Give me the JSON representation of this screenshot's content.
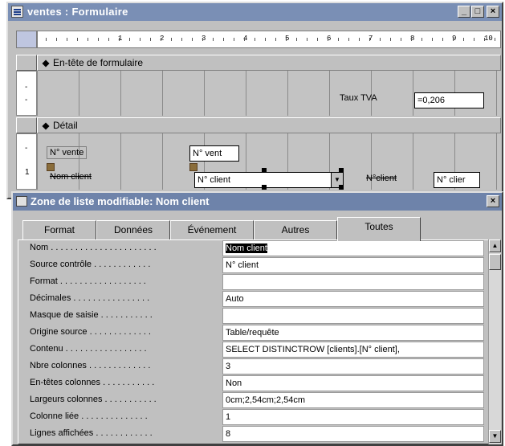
{
  "form_window": {
    "title": "ventes : Formulaire",
    "controls": {
      "minimize": "_",
      "maximize": "□",
      "close": "×"
    },
    "ruler_numbers": [
      "1",
      "2",
      "3",
      "4",
      "5",
      "6",
      "7",
      "8",
      "9",
      "10"
    ],
    "vertical_ruler": {
      "header": [
        "-",
        "-"
      ],
      "detail": [
        "-",
        "1"
      ]
    },
    "sections": {
      "header": {
        "label": "En-tête de formulaire",
        "fields": [
          {
            "label": "Taux TVA",
            "value": "=0,206"
          }
        ]
      },
      "detail": {
        "label": "Détail",
        "fields": [
          {
            "label": "N° vente",
            "value": "N° vent"
          },
          {
            "label": "Nom client",
            "value": "N° client"
          },
          {
            "label": "N°client",
            "value": "N° clier"
          }
        ]
      }
    }
  },
  "property_sheet": {
    "title": "Zone de liste modifiable: Nom client",
    "close": "×",
    "tabs": [
      "Format",
      "Données",
      "Événement",
      "Autres",
      "Toutes"
    ],
    "active_tab": "Toutes",
    "rows": [
      {
        "name": "Nom . . . . . . . . . . . . . . . . . . . . . .",
        "value": "Nom client"
      },
      {
        "name": "Source contrôle . . . . . . . . . . . .",
        "value": "N° client"
      },
      {
        "name": "Format . . . . . . . . . . . . . . . . . .",
        "value": ""
      },
      {
        "name": "Décimales . . . . . . . . . . . . . . . .",
        "value": "Auto"
      },
      {
        "name": "Masque de saisie . . . . . . . . . . .",
        "value": ""
      },
      {
        "name": "Origine source . . . . . . . . . . . . .",
        "value": "Table/requête"
      },
      {
        "name": "Contenu . . . . . . . . . . . . . . . . .",
        "value": "SELECT DISTINCTROW [clients].[N° client],"
      },
      {
        "name": "Nbre colonnes . . . . . . . . . . . . .",
        "value": "3"
      },
      {
        "name": "En-têtes colonnes . . . . . . . . . . .",
        "value": "Non"
      },
      {
        "name": "Largeurs colonnes . . . . . . . . . . .",
        "value": "0cm;2,54cm;2,54cm"
      },
      {
        "name": "Colonne liée . . . . . . . . . . . . . .",
        "value": "1"
      },
      {
        "name": "Lignes affichées . . . . . . . . . . . .",
        "value": "8"
      }
    ]
  },
  "colors": {
    "title_active": "#7a8fb5",
    "face": "#c0c0c0"
  }
}
